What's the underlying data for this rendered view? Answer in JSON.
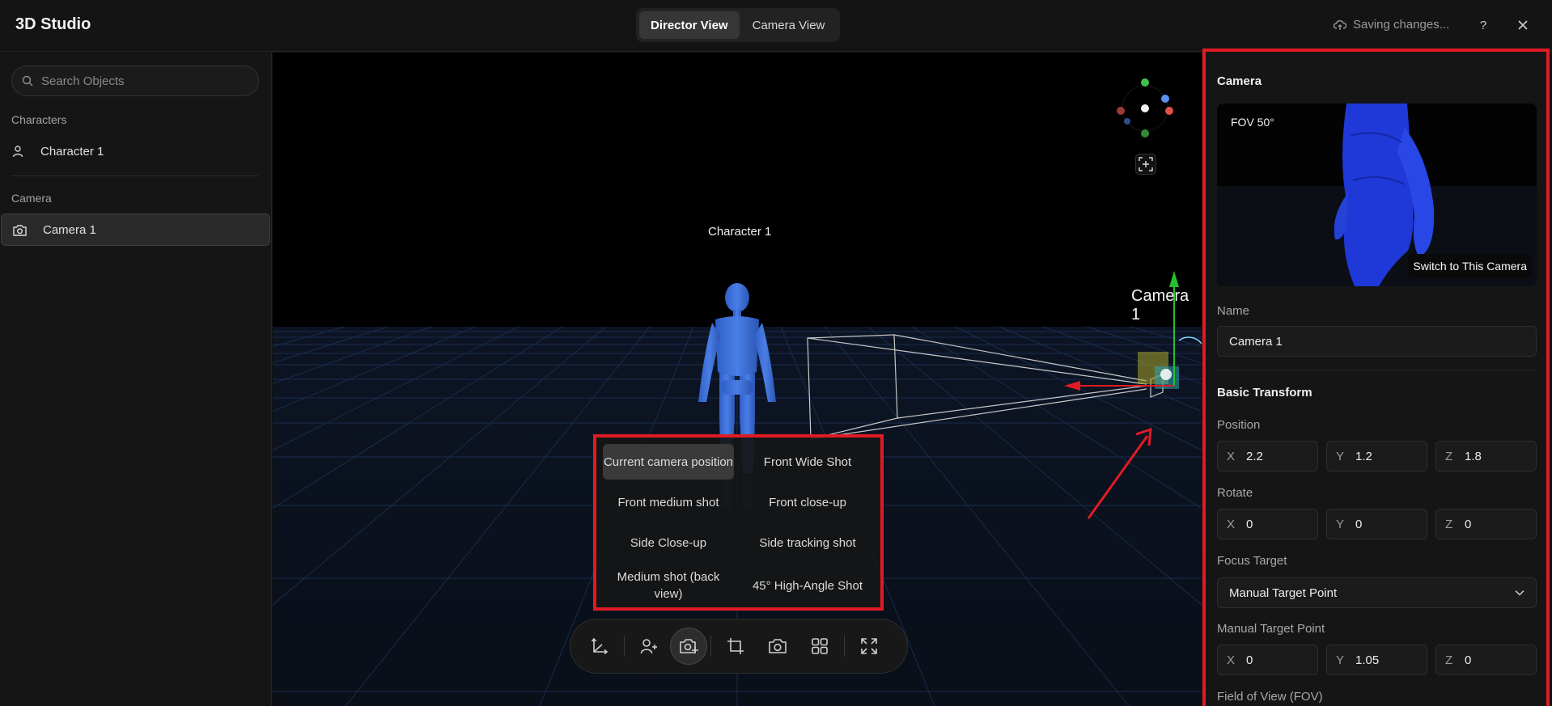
{
  "app": {
    "title": "3D Studio"
  },
  "view_toggle": {
    "director": "Director View",
    "camera": "Camera View",
    "active": "Director View"
  },
  "header": {
    "saving": "Saving changes...",
    "help": "?",
    "close": "✕"
  },
  "sidebar": {
    "search_placeholder": "Search Objects",
    "sections": [
      {
        "label": "Characters",
        "items": [
          {
            "label": "Character 1",
            "icon": "user-icon"
          }
        ]
      },
      {
        "label": "Camera",
        "items": [
          {
            "label": "Camera 1",
            "icon": "camera-icon",
            "selected": true
          }
        ]
      }
    ]
  },
  "viewport": {
    "character_label": "Character 1",
    "camera_label": "Camera 1",
    "presets": [
      "Current camera position",
      "Front Wide Shot",
      "Front medium shot",
      "Front close-up",
      "Side Close-up",
      "Side tracking shot",
      "Medium shot (back view)",
      "45° High-Angle Shot"
    ],
    "active_preset": "Current camera position",
    "toolbar": [
      "transform-axes",
      "add-character",
      "add-camera",
      "crop",
      "screenshot",
      "grid-layout",
      "fullscreen"
    ],
    "accent_red": "#e01b24"
  },
  "panel": {
    "camera_title": "Camera",
    "preview": {
      "fov_tag": "FOV 50°",
      "switch_button": "Switch to This Camera"
    },
    "name_label": "Name",
    "name_value": "Camera 1",
    "basic_transform": "Basic Transform",
    "position_label": "Position",
    "position": {
      "x": "2.2",
      "y": "1.2",
      "z": "1.8"
    },
    "rotate_label": "Rotate",
    "rotate": {
      "x": "0",
      "y": "0",
      "z": "0"
    },
    "focus_target_label": "Focus Target",
    "focus_target_value": "Manual Target Point",
    "manual_target_label": "Manual Target Point",
    "manual_target": {
      "x": "0",
      "y": "1.05",
      "z": "0"
    },
    "fov_label": "Field of View (FOV)",
    "axis_labels": {
      "x": "X",
      "y": "Y",
      "z": "Z"
    }
  }
}
